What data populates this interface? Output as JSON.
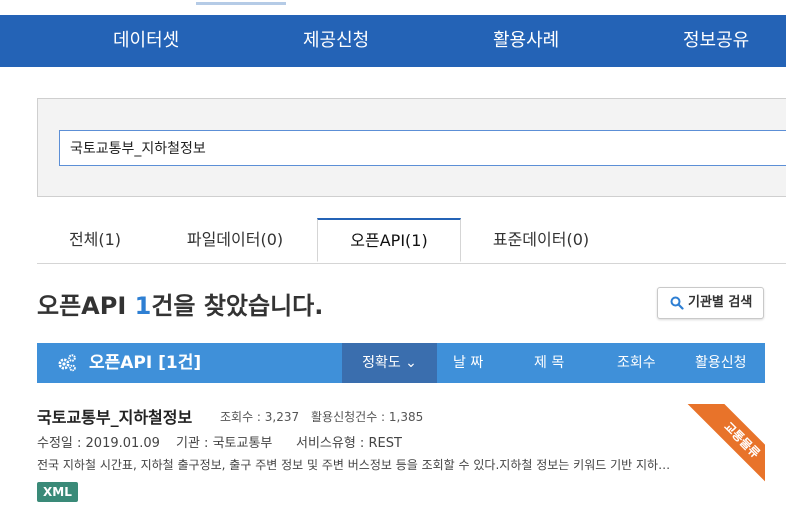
{
  "nav": {
    "items": [
      "데이터셋",
      "제공신청",
      "활용사례",
      "정보공유"
    ]
  },
  "search": {
    "value": "국토교통부_지하철정보"
  },
  "tabs": [
    {
      "label": "전체(1)"
    },
    {
      "label": "파일데이터(0)"
    },
    {
      "label": "오픈API(1)"
    },
    {
      "label": "표준데이터(0)"
    }
  ],
  "result": {
    "prefix": "오픈API ",
    "count": "1",
    "suffix": "건을 찾았습니다."
  },
  "institution_button": "기관별 검색",
  "bar": {
    "title": "오픈API [1건]",
    "sort_options": [
      "정확도 ⌄",
      "날 짜",
      "제 목",
      "조회수",
      "활용신청"
    ]
  },
  "item": {
    "title": "국토교통부_지하철정보",
    "views": "조회수 : 3,237",
    "apps": "활용신청건수 : 1,385",
    "modified": "수정일 : 2019.01.09",
    "agency": "기관 : 국토교통부",
    "service_type": "서비스유형 : REST",
    "description": "전국 지하철 시간표, 지하철 출구정보, 출구 주변 정보 및 주변 버스정보 등을 조회할 수 있다.지하철 정보는 키워드 기반 지하…",
    "badge": "XML",
    "ribbon": "교통물류"
  },
  "colors": {
    "nav_bg": "#2463b6",
    "bar_bg": "#3f90d9",
    "accent": "#2e7fd3",
    "badge": "#3a8a78",
    "ribbon": "#e8732a"
  }
}
